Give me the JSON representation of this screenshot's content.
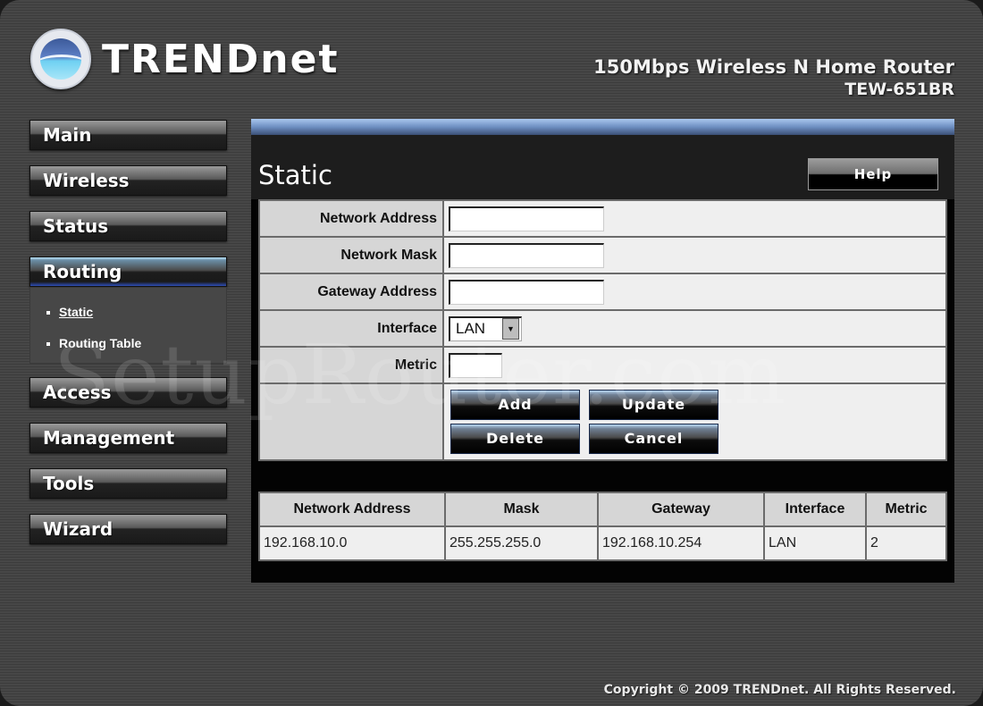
{
  "brand": {
    "logo_text": "TRENDnet",
    "product_name": "150Mbps Wireless N Home Router",
    "model": "TEW-651BR"
  },
  "sidebar": {
    "items": [
      {
        "label": "Main"
      },
      {
        "label": "Wireless"
      },
      {
        "label": "Status"
      },
      {
        "label": "Routing",
        "active": true,
        "subitems": [
          {
            "label": "Static",
            "current": true
          },
          {
            "label": "Routing Table"
          }
        ]
      },
      {
        "label": "Access"
      },
      {
        "label": "Management"
      },
      {
        "label": "Tools"
      },
      {
        "label": "Wizard"
      }
    ]
  },
  "page": {
    "title": "Static",
    "help_label": "Help"
  },
  "form": {
    "fields": [
      {
        "label": "Network Address",
        "value": ""
      },
      {
        "label": "Network Mask",
        "value": ""
      },
      {
        "label": "Gateway Address",
        "value": ""
      },
      {
        "label": "Interface",
        "selected": "LAN"
      },
      {
        "label": "Metric",
        "value": ""
      }
    ],
    "buttons": {
      "add": "Add",
      "update": "Update",
      "delete": "Delete",
      "cancel": "Cancel"
    }
  },
  "routes": {
    "columns": [
      "Network Address",
      "Mask",
      "Gateway",
      "Interface",
      "Metric"
    ],
    "rows": [
      [
        "192.168.10.0",
        "255.255.255.0",
        "192.168.10.254",
        "LAN",
        "2"
      ]
    ]
  },
  "watermark": "SetupRouter.com",
  "footer": {
    "copyright": "Copyright © 2009 TRENDnet. All Rights Reserved."
  },
  "colors": {
    "accent_blue": "#6e8fc2",
    "panel_bg": "#030303",
    "frame_bg": "#434343"
  }
}
